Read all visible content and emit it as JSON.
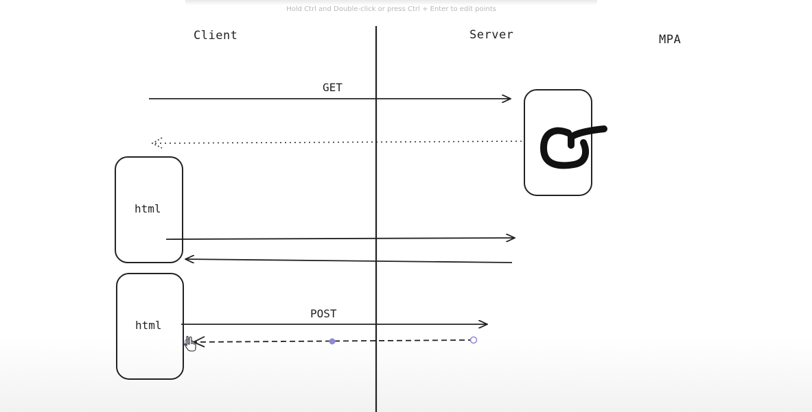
{
  "hint_text": "Hold Ctrl and Double-click or press Ctrl + Enter to edit points",
  "labels": {
    "client": "Client",
    "server": "Server",
    "mpa": "MPA"
  },
  "arrows": {
    "get": "GET",
    "post": "POST"
  },
  "boxes": {
    "html_top": "html",
    "html_bottom": "html"
  },
  "icons": {
    "server_logo": "server-logo-icon",
    "cursor": "hand-cursor-icon"
  },
  "colors": {
    "stroke": "#222222",
    "selection": "#8e89d8"
  }
}
